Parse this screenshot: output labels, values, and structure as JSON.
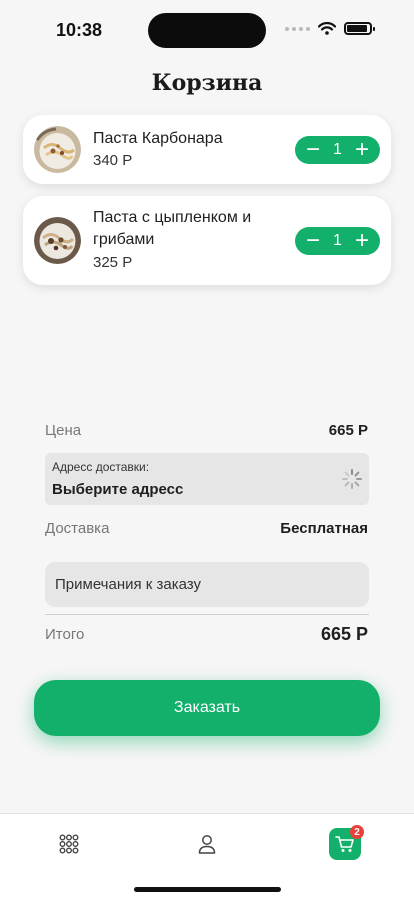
{
  "status_bar": {
    "time": "10:38"
  },
  "page": {
    "title": "Корзина"
  },
  "cart_items": [
    {
      "name": "Паста Карбонара",
      "price": "340 Р",
      "quantity": "1"
    },
    {
      "name": "Паста с цыпленком и грибами",
      "price": "325 Р",
      "quantity": "1"
    }
  ],
  "stepper": {
    "minus_glyph": "−",
    "plus_glyph": "+"
  },
  "summary": {
    "price_label": "Цена",
    "price_value": "665 Р",
    "address_caption": "Адресс доставки:",
    "address_value": "Выберите адресс",
    "delivery_label": "Доставка",
    "delivery_value": "Бесплатная",
    "notes_placeholder": "Примечания к заказу",
    "total_label": "Итого",
    "total_value": "665 Р"
  },
  "order_button": {
    "label": "Заказать"
  },
  "tab_bar": {
    "items": [
      {
        "icon": "grid-menu-icon",
        "active": false
      },
      {
        "icon": "profile-icon",
        "active": false
      },
      {
        "icon": "cart-icon",
        "active": true
      }
    ],
    "cart_badge": "2"
  },
  "colors": {
    "accent": "#13b06b",
    "badge": "#e8403a",
    "background": "#f6f6f6"
  }
}
